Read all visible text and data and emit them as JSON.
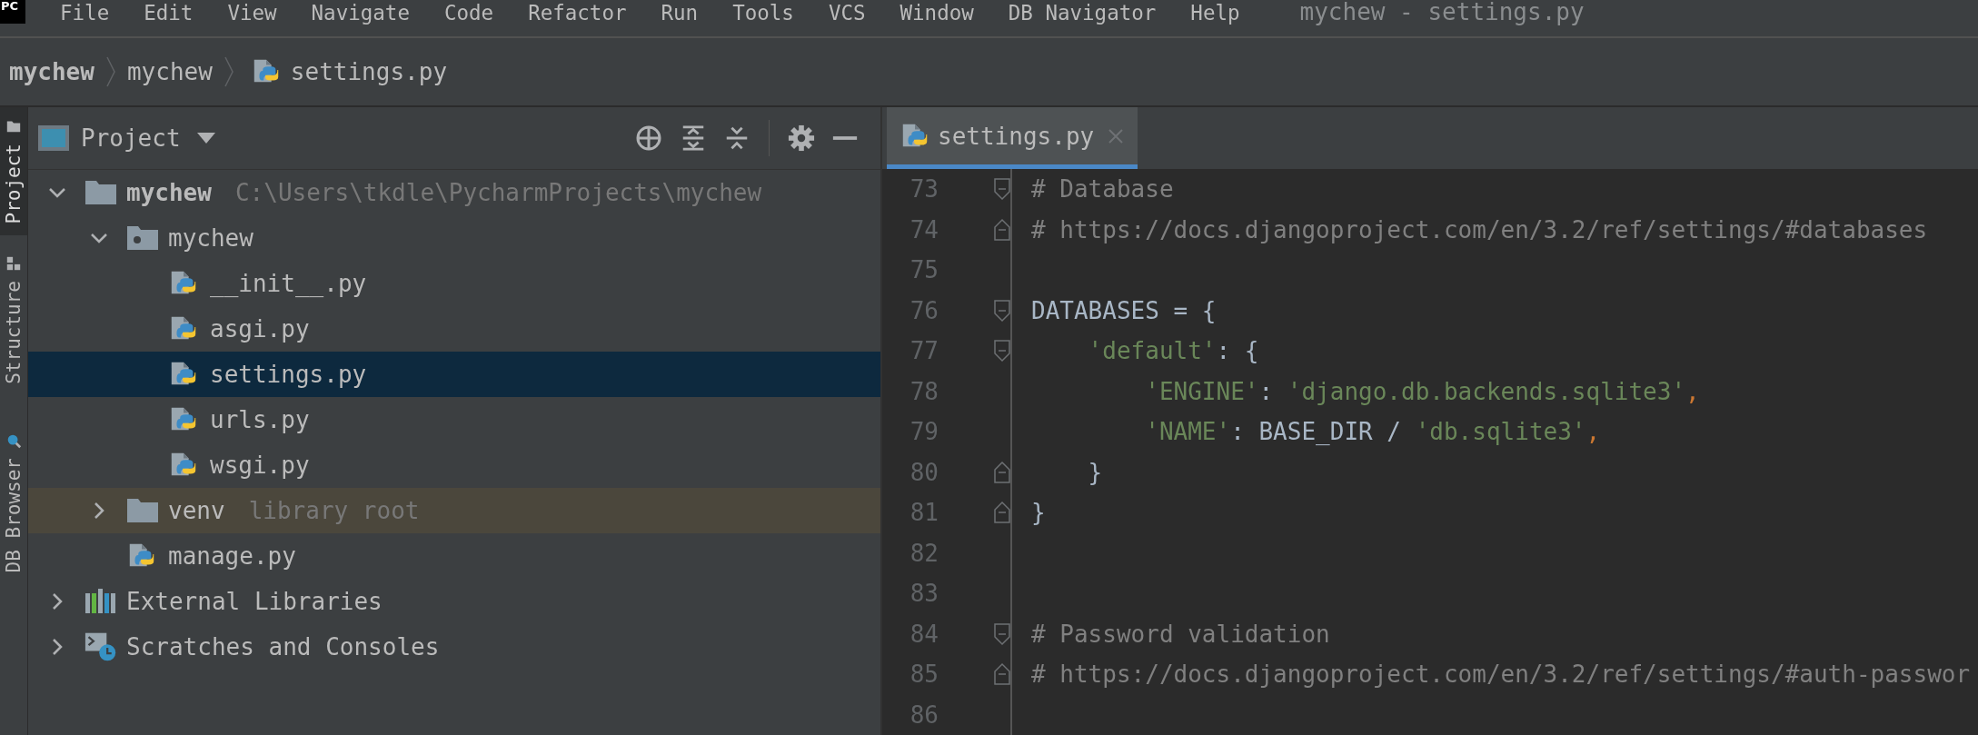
{
  "logo": "PC",
  "menu": [
    "File",
    "Edit",
    "View",
    "Navigate",
    "Code",
    "Refactor",
    "Run",
    "Tools",
    "VCS",
    "Window",
    "DB Navigator",
    "Help"
  ],
  "window": {
    "title": "mychew - settings.py"
  },
  "breadcrumbs": [
    {
      "label": "mychew",
      "kind": "project"
    },
    {
      "label": "mychew",
      "kind": "folder"
    },
    {
      "label": "settings.py",
      "kind": "python"
    }
  ],
  "tool_windows": [
    {
      "label": "Project",
      "kind": "project",
      "selected": true
    },
    {
      "label": "Structure",
      "kind": "structure",
      "selected": false
    },
    {
      "label": "DB Browser",
      "kind": "db",
      "selected": false
    }
  ],
  "project_panel": {
    "title": "Project"
  },
  "tree": [
    {
      "label": "mychew",
      "hint": "C:\\Users\\tkdle\\PycharmProjects\\mychew",
      "kind": "folder",
      "expanded": true,
      "selected": false,
      "highlighted": false,
      "children": [
        {
          "label": "mychew",
          "kind": "package",
          "expanded": true,
          "selected": false,
          "highlighted": false,
          "children": [
            {
              "label": "__init__.py",
              "kind": "python",
              "selected": false,
              "highlighted": false
            },
            {
              "label": "asgi.py",
              "kind": "python",
              "selected": false,
              "highlighted": false
            },
            {
              "label": "settings.py",
              "kind": "python",
              "selected": true,
              "highlighted": false
            },
            {
              "label": "urls.py",
              "kind": "python",
              "selected": false,
              "highlighted": false
            },
            {
              "label": "wsgi.py",
              "kind": "python",
              "selected": false,
              "highlighted": false
            }
          ]
        },
        {
          "label": "venv",
          "hint": "library root",
          "kind": "folder",
          "expanded": false,
          "selected": false,
          "highlighted": true
        },
        {
          "label": "manage.py",
          "kind": "python",
          "selected": false,
          "highlighted": false
        }
      ]
    },
    {
      "label": "External Libraries",
      "kind": "libraries",
      "expanded": false,
      "selected": false,
      "highlighted": false
    },
    {
      "label": "Scratches and Consoles",
      "kind": "scratches",
      "expanded": false,
      "selected": false,
      "highlighted": false
    }
  ],
  "editor_tabs": [
    {
      "label": "settings.py",
      "selected": true
    }
  ],
  "code": [
    {
      "number": "73",
      "fold_start": true,
      "fold_end": false,
      "tokens": [
        {
          "kind": "comment",
          "text": "# Database"
        }
      ]
    },
    {
      "number": "74",
      "fold_start": false,
      "fold_end": true,
      "tokens": [
        {
          "kind": "comment",
          "text": "# https://docs.djangoproject.com/en/3.2/ref/settings/#databases"
        }
      ]
    },
    {
      "number": "75",
      "fold_start": false,
      "fold_end": false
    },
    {
      "number": "76",
      "fold_start": true,
      "fold_end": false,
      "tokens": [
        {
          "kind": "plain",
          "text": "DATABASES = {"
        }
      ]
    },
    {
      "number": "77",
      "fold_start": true,
      "fold_end": false,
      "tokens": [
        {
          "kind": "string",
          "text": "    'default'"
        },
        {
          "kind": "plain",
          "text": ": {"
        }
      ]
    },
    {
      "number": "78",
      "fold_start": false,
      "fold_end": false,
      "tokens": [
        {
          "kind": "string",
          "text": "        'ENGINE'"
        },
        {
          "kind": "plain",
          "text": ": "
        },
        {
          "kind": "string",
          "text": "'django.db.backends.sqlite3'"
        },
        {
          "kind": "keyword",
          "text": ","
        }
      ]
    },
    {
      "number": "79",
      "fold_start": false,
      "fold_end": false,
      "tokens": [
        {
          "kind": "string",
          "text": "        'NAME'"
        },
        {
          "kind": "plain",
          "text": ": BASE_DIR / "
        },
        {
          "kind": "string",
          "text": "'db.sqlite3'"
        },
        {
          "kind": "keyword",
          "text": ","
        }
      ]
    },
    {
      "number": "80",
      "fold_start": false,
      "fold_end": true,
      "tokens": [
        {
          "kind": "plain",
          "text": "    }"
        }
      ]
    },
    {
      "number": "81",
      "fold_start": false,
      "fold_end": true,
      "tokens": [
        {
          "kind": "plain",
          "text": "}"
        }
      ]
    },
    {
      "number": "82",
      "fold_start": false,
      "fold_end": false
    },
    {
      "number": "83",
      "fold_start": false,
      "fold_end": false
    },
    {
      "number": "84",
      "fold_start": true,
      "fold_end": false,
      "tokens": [
        {
          "kind": "comment",
          "text": "# Password validation"
        }
      ]
    },
    {
      "number": "85",
      "fold_start": false,
      "fold_end": true,
      "tokens": [
        {
          "kind": "comment",
          "text": "# https://docs.djangoproject.com/en/3.2/ref/settings/#auth-passwor"
        }
      ]
    },
    {
      "number": "86",
      "fold_start": false,
      "fold_end": false
    }
  ]
}
